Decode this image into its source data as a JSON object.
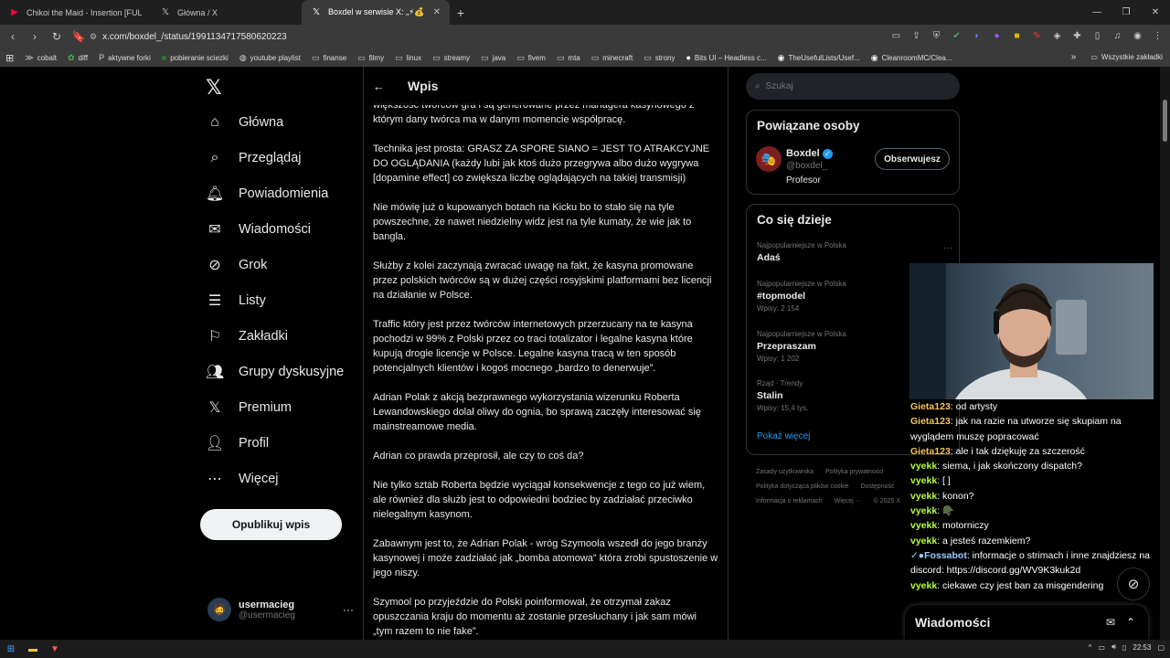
{
  "browser": {
    "tabs": [
      {
        "title": "Chikoi the Maid - Insertion [FULL",
        "icon": "youtube-icon",
        "active": false
      },
      {
        "title": "Główna / X",
        "icon": "x-icon",
        "active": false
      },
      {
        "title": "Boxdel w serwisie X: „⚡💰 INFLU",
        "icon": "x-icon",
        "active": true
      }
    ],
    "url": "x.com/boxdel_/status/1991134717580620223",
    "bookmarks": [
      "cobalt",
      "diff",
      "aktywne forki",
      "pobieranie sciezki",
      "youtube playlist",
      "finanse",
      "filmy",
      "linux",
      "streamy",
      "java",
      "fivem",
      "mta",
      "minecraft",
      "strony",
      "Bits UI – Headless c...",
      "TheUsefulLists/Usef...",
      "CleanroomMC/Clea..."
    ],
    "bookmarks_more": "»",
    "bookmarks_all": "Wszystkie zakładki"
  },
  "nav": {
    "items": [
      {
        "label": "Główna",
        "icon": "home-icon"
      },
      {
        "label": "Przeglądaj",
        "icon": "search-icon"
      },
      {
        "label": "Powiadomienia",
        "icon": "bell-icon"
      },
      {
        "label": "Wiadomości",
        "icon": "mail-icon"
      },
      {
        "label": "Grok",
        "icon": "grok-icon"
      },
      {
        "label": "Listy",
        "icon": "list-icon"
      },
      {
        "label": "Zakładki",
        "icon": "bookmark-icon"
      },
      {
        "label": "Grupy dyskusyjne",
        "icon": "people-icon"
      },
      {
        "label": "Premium",
        "icon": "x-icon"
      },
      {
        "label": "Profil",
        "icon": "person-icon"
      },
      {
        "label": "Więcej",
        "icon": "more-icon"
      }
    ],
    "post_button": "Opublikuj wpis",
    "user": {
      "name": "usermacieg",
      "handle": "@usermacieg"
    }
  },
  "main": {
    "header": "Wpis",
    "paragraphs": [
      "większość twórców gra i są generowane przez managera kasynowego z którym dany twórca ma w danym momencie współpracę.",
      "Technika jest prosta: GRASZ ZA SPORE SIANO = JEST TO ATRAKCYJNE DO OGLĄDANIA (każdy lubi jak ktoś dużo przegrywa albo dużo wygrywa [dopamine effect] co zwiększa liczbę oglądających na takiej transmisji)",
      "Nie mówię już o kupowanych botach na Kicku bo to stało się na tyle powszechne, że nawet niedzielny widz jest na tyle kumaty, że wie jak to bangla.",
      "Służby z kolei zaczynają zwracać uwagę na fakt, że kasyna promowane przez polskich twórców są w dużej części rosyjskimi platformami bez licencji na działanie w Polsce.",
      "Traffic który jest przez twórców internetowych przerzucany na te kasyna pochodzi w 99% z Polski przez co traci totalizator i legalne kasyna które kupują drogie licencje w Polsce. Legalne kasyna tracą w ten sposób potencjalnych klientów i kogoś mocnego „bardzo to denerwuje”.",
      "Adrian Polak z akcją bezprawnego wykorzystania wizerunku Roberta Lewandowskiego dolał oliwy do ognia, bo sprawą zaczęły interesować się mainstreamowe media.",
      "Adrian co prawda przeprosił, ale czy to coś da?",
      "Nie tylko sztab Roberta będzie wyciągał konsekwencje z tego co już wiem, ale również dla służb jest to odpowiedni bodziec by zadziałać przeciwko nielegalnym kasynom.",
      "Zabawnym jest to, że Adrian Polak - wróg Szymoola wszedł do jego branży kasynowej i może zadziałać jak „bomba atomowa” która zrobi spustoszenie w jego niszy.",
      "Szymool po przyjeździe do Polski poinformował, że otrzymał zakaz opuszczania kraju do momentu aż zostanie przesłuchany i jak sam mówi „tym razem to nie fake”."
    ]
  },
  "sidebar": {
    "search_placeholder": "Szukaj",
    "related_title": "Powiązane osoby",
    "related_person": {
      "name": "Boxdel",
      "handle": "@boxdel_",
      "bio": "Profesor",
      "follow_label": "Obserwujesz"
    },
    "trends_title": "Co się dzieje",
    "trends": [
      {
        "context": "Najpopularniejsze w Polska",
        "name": "Adaś",
        "posts": ""
      },
      {
        "context": "Najpopularniejsze w Polska",
        "name": "#topmodel",
        "posts": "Wpisy: 2 154"
      },
      {
        "context": "Najpopularniejsze w Polska",
        "name": "Przepraszam",
        "posts": "Wpisy: 1 202"
      },
      {
        "context": "Rząd · Trendy",
        "name": "Stalin",
        "posts": "Wpisy: 15,4 tys."
      }
    ],
    "show_more": "Pokaż więcej",
    "footer": [
      "Zasady użytkownika",
      "Polityka prywatności",
      "Polityka dotycząca plików cookie",
      "Dostępność",
      "Informacja o reklamach",
      "Więcej ···",
      "© 2025 X"
    ]
  },
  "overlay": {
    "chat": [
      {
        "user": "Gieta123",
        "text": "od artysty",
        "style": "u1"
      },
      {
        "user": "Gieta123",
        "text": "jak na razie na utworze się skupiam na wyglądem muszę popracować",
        "style": "u1"
      },
      {
        "user": "Gieta123",
        "text": "ale i tak dziękuję za szczerość",
        "style": "u1"
      },
      {
        "user": "vyekk",
        "text": "siema, i jak skończony dispatch?",
        "style": "u2"
      },
      {
        "user": "vyekk",
        "text": "[ ]",
        "style": "u2"
      },
      {
        "user": "vyekk",
        "text": "konon?",
        "style": "u2"
      },
      {
        "user": "vyekk",
        "text": "🪖",
        "style": "u2"
      },
      {
        "user": "vyekk",
        "text": "motorniczy",
        "style": "u2"
      },
      {
        "user": "vyekk",
        "text": "a jesteś razemkiem?",
        "style": "u2"
      },
      {
        "user": "✓●Fossabot",
        "text": "informacje o strimach i inne znajdziesz na discord: https://discord.gg/WV9K3kuk2d",
        "style": "u3"
      },
      {
        "user": "vyekk",
        "text": "ciekawe czy jest ban za misgendering",
        "style": "u2"
      }
    ],
    "messages_drawer": "Wiadomości"
  },
  "taskbar": {
    "time": "22:53"
  }
}
